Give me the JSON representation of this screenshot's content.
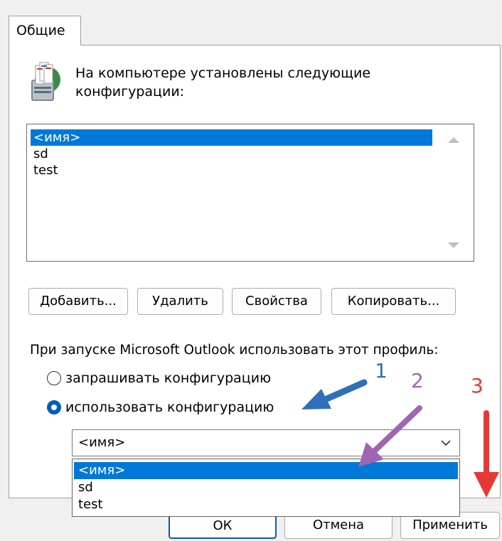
{
  "tab": {
    "label": "Общие"
  },
  "heading": {
    "text": "На компьютере установлены следующие конфигурации:",
    "icon": "mail-profile-icon"
  },
  "profiles": {
    "items": [
      {
        "label": "<имя>",
        "selected": true
      },
      {
        "label": "sd",
        "selected": false
      },
      {
        "label": "test",
        "selected": false
      }
    ]
  },
  "buttons": {
    "add": "Добавить...",
    "remove": "Удалить",
    "properties": "Свойства",
    "copy": "Копировать..."
  },
  "startup": {
    "label": "При запуске Microsoft Outlook использовать этот профиль:",
    "option_prompt": "запрашивать конфигурацию",
    "option_use": "использовать конфигурацию",
    "selected_option": "use"
  },
  "combo": {
    "value": "<имя>",
    "options": [
      {
        "label": "<имя>",
        "selected": true
      },
      {
        "label": "sd",
        "selected": false
      },
      {
        "label": "test",
        "selected": false
      }
    ]
  },
  "footer": {
    "ok": "ОК",
    "cancel": "Отмена",
    "apply": "Применить"
  },
  "annotations": [
    {
      "label": "1",
      "color": "#2f6fba"
    },
    {
      "label": "2",
      "color": "#a064b4"
    },
    {
      "label": "3",
      "color": "#e53935"
    }
  ],
  "colors": {
    "selection": "#0078d7",
    "accent": "#005fb8"
  }
}
